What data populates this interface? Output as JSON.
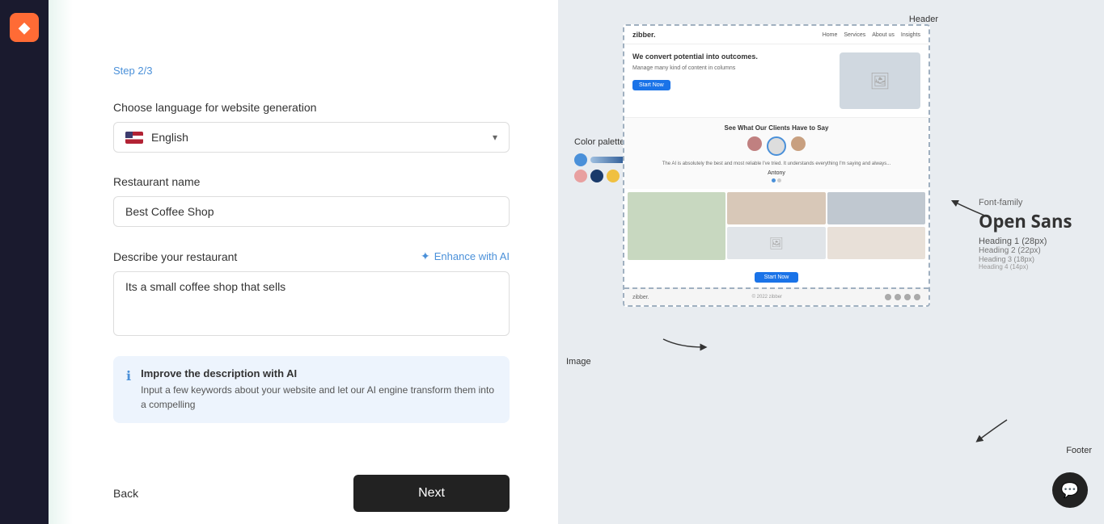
{
  "sidebar": {
    "logo": "◆"
  },
  "leftPanel": {
    "stepLabel": "Step 2/3",
    "languageSection": {
      "label": "Choose language for website generation",
      "selectedLanguage": "English"
    },
    "restaurantNameSection": {
      "label": "Restaurant name",
      "placeholder": "Best Coffee Shop",
      "value": "Best Coffee Shop"
    },
    "descriptionSection": {
      "label": "Describe your restaurant",
      "enhanceLabel": "Enhance with AI",
      "placeholder": "Its a small coffee shop that sells",
      "value": "Its a small coffee shop that sells"
    },
    "aiInfoBox": {
      "title": "Improve the description with AI",
      "text": "Input a few keywords about your website and let our AI engine transform them into a compelling"
    },
    "backLabel": "Back",
    "nextLabel": "Next"
  },
  "rightPanel": {
    "annotations": {
      "header": "Header",
      "colorPalette": "Color palette",
      "image": "Image",
      "footer": "Footer",
      "fontFamily": "Font-family"
    },
    "fontFamilyName": "Open Sans",
    "headings": {
      "h1": "Heading 1 (28px)",
      "h2": "Heading 2 (22px)",
      "h3": "Heading 3 (18px)",
      "h4": "Heading 4 (14px)"
    },
    "colorPalette": {
      "row1": [
        "#4a90d9",
        "#a0c0e0",
        "#1a4a8a"
      ],
      "row2": [
        "#e8a0a0",
        "#1a3a6a",
        "#f0c040",
        "#e86820"
      ]
    },
    "mockup": {
      "logoText": "zibber.",
      "navItems": [
        "Home",
        "Services",
        "About us",
        "Insights"
      ],
      "heroTitle": "We convert potential into outcomes.",
      "heroSub": "Manage many kind of content in columns",
      "heroCta": "Start Now",
      "testimonialTitle": "See What Our Clients Have to Say",
      "footerLogo": "zibber.",
      "footerCopy": "© 2022 zibber",
      "ctaBtn": "Start Now"
    },
    "chatIcon": "💬"
  }
}
